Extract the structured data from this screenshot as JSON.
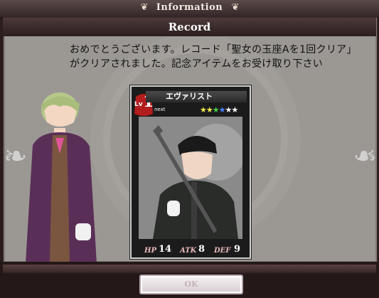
{
  "topbar": {
    "title": "Information",
    "left_icon": "fleur-icon",
    "right_icon": "fleur-icon"
  },
  "dialog": {
    "header": "Record",
    "message": "おめでとうございます。レコード「聖女の玉座Aを1回クリア」がクリアされました。記念アイテムをお受け取り下さい"
  },
  "card": {
    "name": "エヴァリスト",
    "level_label": "Lv",
    "level": "1",
    "next_label": "next",
    "stars": [
      "#f2e94e",
      "#f2e94e",
      "#47d14a",
      "#4a83ff",
      "#ffffff",
      "#ffffff"
    ],
    "hp_label": "HP",
    "hp": "14",
    "atk_label": "ATK",
    "atk": "8",
    "def_label": "DEF",
    "def": "9"
  },
  "buttons": {
    "ok_label": "OK"
  }
}
